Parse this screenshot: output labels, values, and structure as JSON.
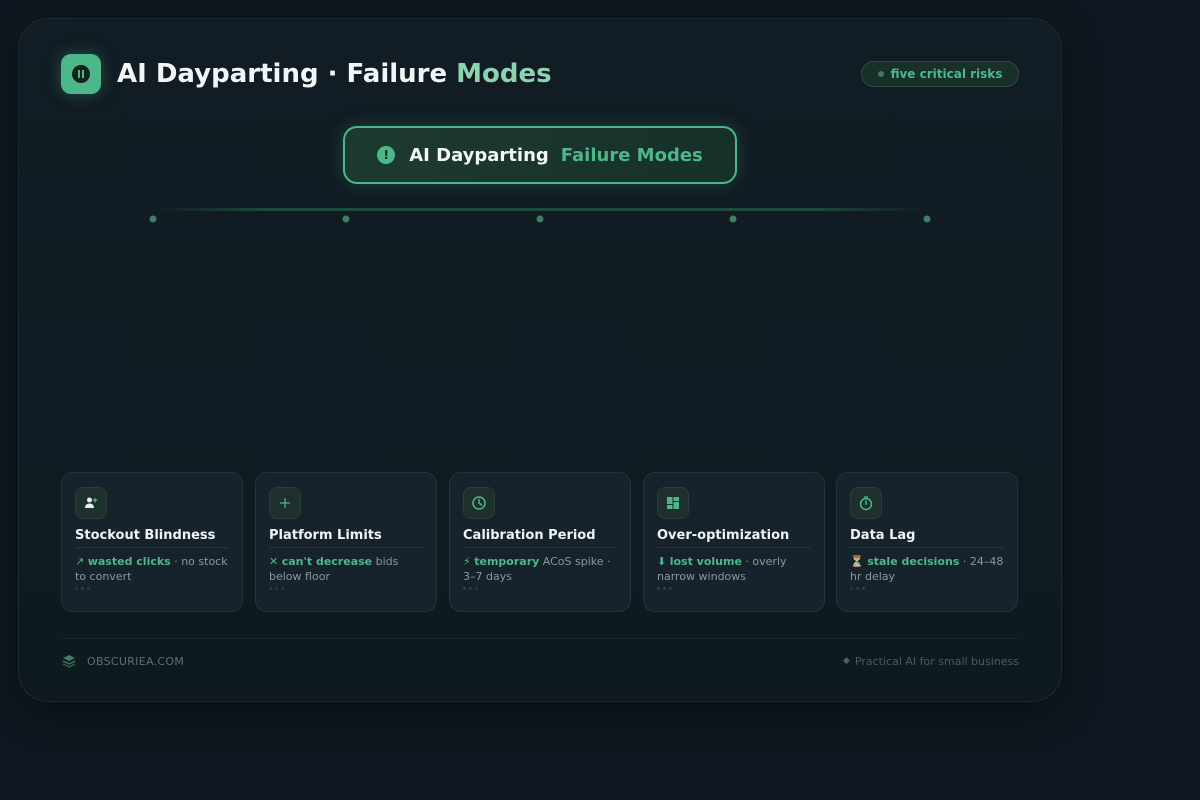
{
  "header": {
    "title_main": "AI Dayparting · Failure ",
    "title_accent": "Modes",
    "logo_icon": "pause-circle-icon",
    "badge": "five critical risks"
  },
  "root": {
    "label_main": "AI Dayparting",
    "label_accent": "Failure Modes",
    "icon": "alert-circle-icon"
  },
  "nodes": [
    {
      "icon": "person-add-icon",
      "title": "Stockout Blindness",
      "symbol": "↗",
      "emphasis": "wasted clicks",
      "detail": " · no stock to convert"
    },
    {
      "icon": "plus-icon",
      "title": "Platform Limits",
      "symbol": "✕",
      "emphasis": "can't decrease",
      "detail": " bids below floor"
    },
    {
      "icon": "clock-icon",
      "title": "Calibration Period",
      "symbol": "⚡",
      "emphasis": "temporary",
      "detail": " ACoS spike · 3–7 days"
    },
    {
      "icon": "dashboard-icon",
      "title": "Over-optimization",
      "symbol": "⬇",
      "emphasis": "lost volume",
      "detail": " · overly narrow windows"
    },
    {
      "icon": "timer-icon",
      "title": "Data Lag",
      "symbol": "⏳",
      "emphasis": "stale decisions",
      "detail": " · 24–48 hr delay"
    }
  ],
  "footer": {
    "brand": "OBSCURIEA.COM",
    "brand_icon": "layers-icon",
    "tagline": "Practical AI for small business"
  },
  "colors": {
    "accent": "#4cb88a",
    "background": "#0f1820",
    "card": "#16222c"
  }
}
